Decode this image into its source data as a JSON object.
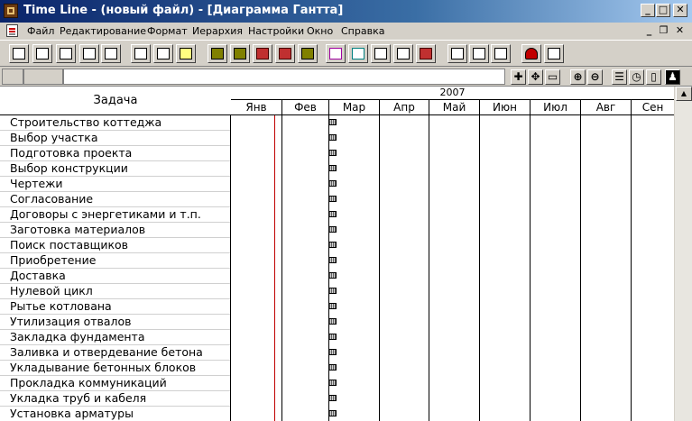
{
  "window": {
    "title": "Time Line - (новый файл) - [Диаграмма Гантта]"
  },
  "titlebar_buttons": {
    "minimize": "_",
    "maximize": "□",
    "close": "✕"
  },
  "mdi_buttons": {
    "minimize": "_",
    "restore": "❐",
    "close": "✕"
  },
  "menu": [
    "Файл",
    "Редактирование",
    "Формат",
    "Иерархия",
    "Настройки",
    "Окно",
    "Справка"
  ],
  "task_column_header": "Задача",
  "timeline": {
    "year": "2007",
    "months": [
      "Янв",
      "Фев",
      "Мар",
      "Апр",
      "Май",
      "Июн",
      "Июл",
      "Авг",
      "Сен"
    ]
  },
  "tasks": [
    "Строительство коттеджа",
    "Выбор участка",
    "Подготовка проекта",
    "Выбор конструкции",
    "Чертежи",
    "Согласование",
    "Договоры с энергетиками и т.п.",
    "Заготовка материалов",
    "Поиск поставщиков",
    "Приобретение",
    "Доставка",
    "Нулевой цикл",
    "Рытье котлована",
    "Утилизация отвалов",
    "Закладка фундамента",
    "Заливка и отвердевание бетона",
    "Укладывание бетонных блоков",
    "Прокладка коммуникаций",
    "Укладка труб и кабеля",
    "Установка арматуры"
  ],
  "toolbar_icons": [
    "new-project-icon",
    "new-icon",
    "print-icon",
    "copy-window-icon",
    "table-icon",
    "cut-icon",
    "paste-icon",
    "paste-special-icon",
    "outline-icon",
    "list-icon",
    "outdent-icon",
    "indent-icon",
    "sort-icon",
    "font-f-icon",
    "font-h-icon",
    "link-icon",
    "resource-icon",
    "calendar-icon",
    "grid-icon",
    "multi-window-icon",
    "percent-100-icon",
    "face-icon",
    "help-pointer-icon"
  ],
  "view_icons": [
    "add-icon",
    "move-icon",
    "window-icon",
    "zoom-in-icon",
    "zoom-out-icon",
    "list-view-icon",
    "clock-icon",
    "note-icon",
    "person-icon"
  ],
  "view_glyphs": [
    "✚",
    "✥",
    "▭",
    "⊕",
    "⊖",
    "☰",
    "◷",
    "▯",
    "♟"
  ]
}
